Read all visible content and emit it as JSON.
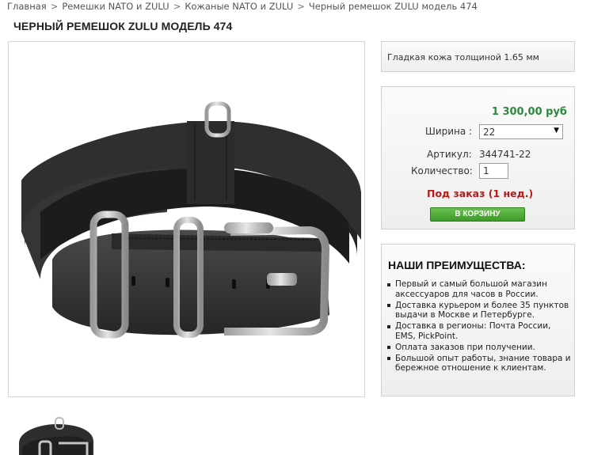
{
  "breadcrumb": {
    "items": [
      "Главная",
      "Ремешки NATO и ZULU",
      "Кожаные NATO и ZULU",
      "Черный ремешок ZULU модель 474"
    ],
    "separator": ">"
  },
  "product": {
    "title": "ЧЕРНЫЙ РЕМЕШОК ZULU МОДЕЛЬ 474",
    "description": "Гладкая кожа толщиной 1.65 мм",
    "price": "1 300,00 руб",
    "width_label": "Ширина :",
    "width_value": "22",
    "article_label": "Артикул:",
    "article_value": "344741-22",
    "quantity_label": "Количество:",
    "quantity_value": "1",
    "availability": "Под заказ (1 нед.)",
    "cart_button": "В КОРЗИНУ"
  },
  "advantages": {
    "title": "НАШИ ПРЕИМУЩЕСТВА:",
    "items": [
      "Первый и самый большой магазин аксессуаров для часов в России.",
      "Доставка курьером и более 35 пунктов выдачи в Москве и Петербурге.",
      "Доставка в регионы: Почта России, EMS, PickPoint.",
      "Оплата заказов при получении.",
      "Большой опыт работы, знание товара и бережное отношение к клиентам."
    ]
  },
  "colors": {
    "price": "#2a8a3e",
    "availability": "#b31b1b",
    "cart_button": "#4aa835"
  },
  "icons": {
    "select_arrow": "triangle-down-icon"
  }
}
